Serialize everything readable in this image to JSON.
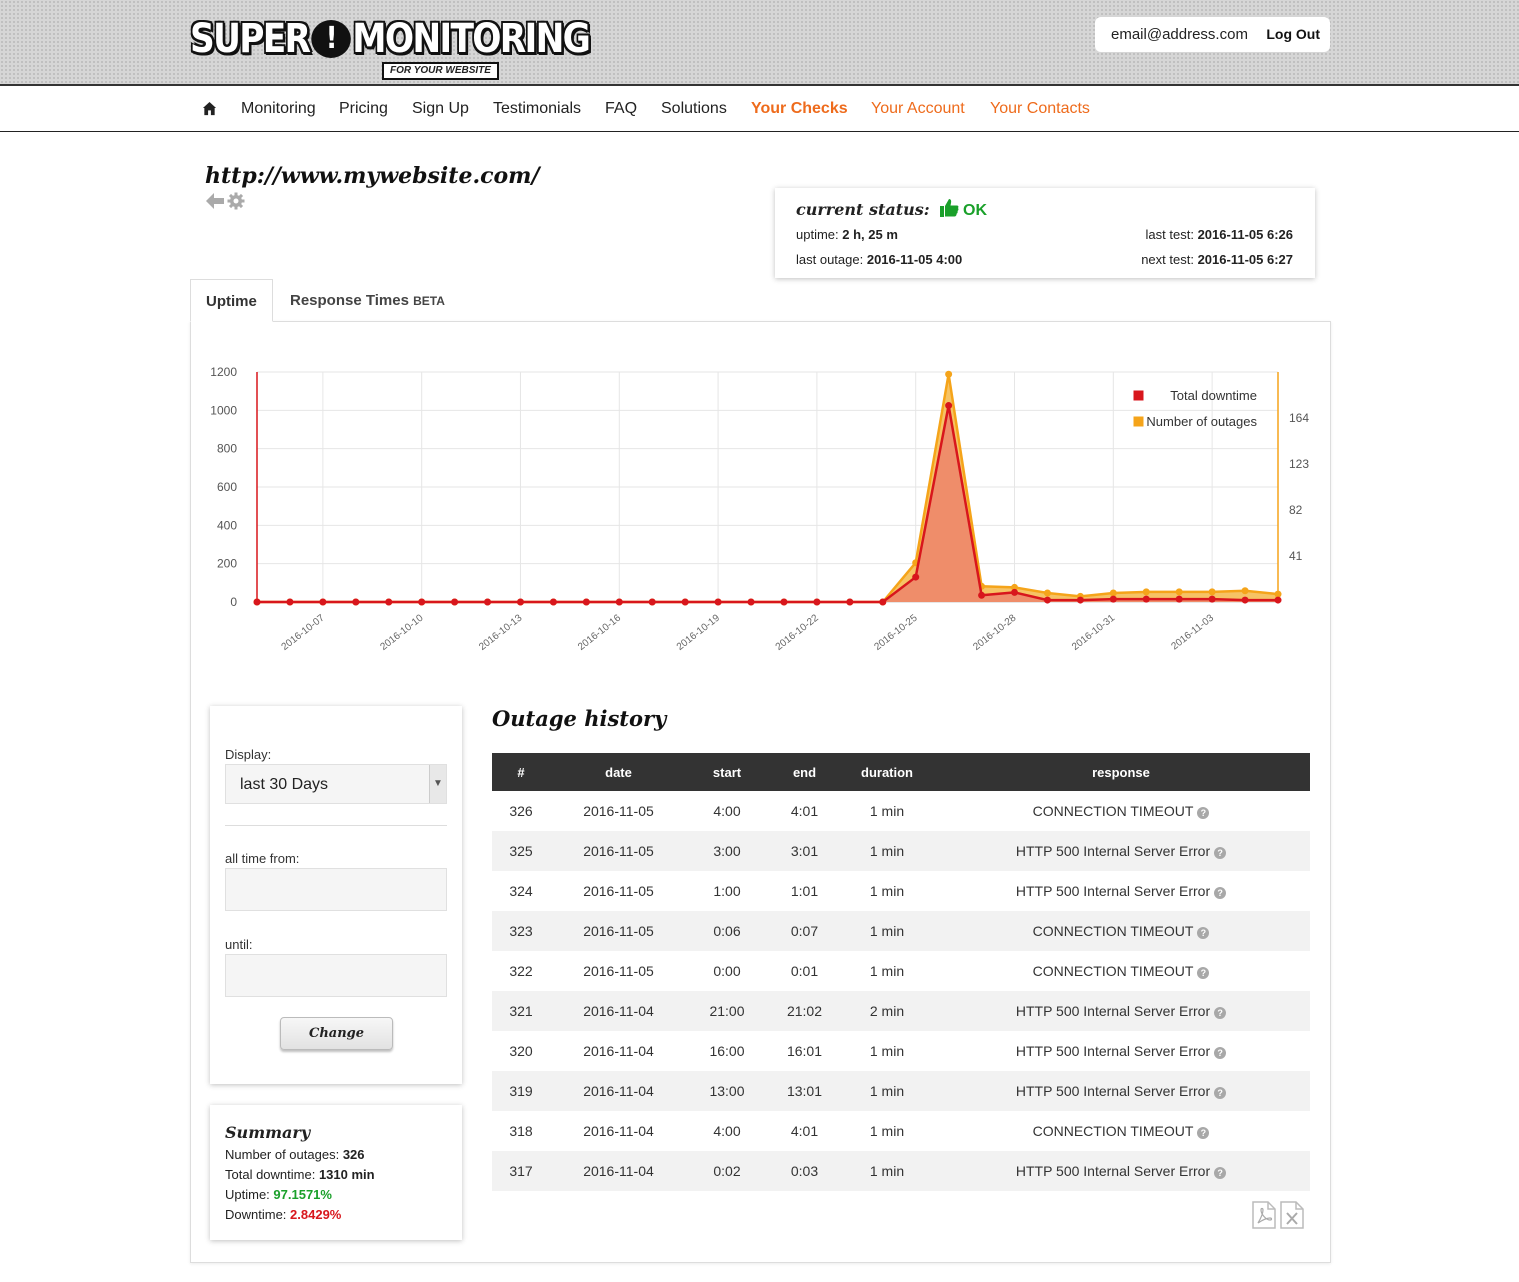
{
  "header": {
    "logo_main_left": "SUPER",
    "logo_mark": "!",
    "logo_main_right": "MONITORING",
    "logo_sub": "FOR YOUR WEBSITE",
    "email": "email@address.com",
    "logout_label": "Log Out"
  },
  "nav": {
    "home_icon": "home-icon",
    "items": [
      "Monitoring",
      "Pricing",
      "Sign Up",
      "Testimonials",
      "FAQ",
      "Solutions",
      "Your Checks",
      "Your Account",
      "Your Contacts"
    ],
    "accent_color": "#ee6b1c"
  },
  "site": {
    "url": "http://www.mywebsite.com/"
  },
  "status": {
    "title": "current status:",
    "state": "OK",
    "uptime_label": "uptime:",
    "uptime_value": "2 h, 25 m",
    "last_outage_label": "last outage:",
    "last_outage_value": "2016-11-05 4:00",
    "last_test_label": "last test:",
    "last_test_value": "2016-11-05 6:26",
    "next_test_label": "next test:",
    "next_test_value": "2016-11-05 6:27",
    "ok_color": "#1aa02a"
  },
  "tabs": {
    "uptime": "Uptime",
    "response": "Response Times",
    "response_badge": "BETA"
  },
  "chart_data": {
    "type": "area",
    "x": [
      "2016-10-05",
      "2016-10-06",
      "2016-10-07",
      "2016-10-08",
      "2016-10-09",
      "2016-10-10",
      "2016-10-11",
      "2016-10-12",
      "2016-10-13",
      "2016-10-14",
      "2016-10-15",
      "2016-10-16",
      "2016-10-17",
      "2016-10-18",
      "2016-10-19",
      "2016-10-20",
      "2016-10-21",
      "2016-10-22",
      "2016-10-23",
      "2016-10-24",
      "2016-10-25",
      "2016-10-26",
      "2016-10-27",
      "2016-10-28",
      "2016-10-29",
      "2016-10-30",
      "2016-10-31",
      "2016-11-01",
      "2016-11-02",
      "2016-11-03",
      "2016-11-04",
      "2016-11-05"
    ],
    "x_tick_labels": [
      "2016-10-07",
      "2016-10-10",
      "2016-10-13",
      "2016-10-16",
      "2016-10-19",
      "2016-10-22",
      "2016-10-25",
      "2016-10-28",
      "2016-10-31",
      "2016-11-03"
    ],
    "series": [
      {
        "name": "Total downtime",
        "axis": "left",
        "color": "#d8161c",
        "fill": "#ee8a6a",
        "values": [
          0,
          0,
          0,
          0,
          0,
          0,
          0,
          0,
          0,
          0,
          0,
          0,
          0,
          0,
          0,
          0,
          0,
          0,
          0,
          0,
          130,
          1025,
          35,
          50,
          10,
          10,
          15,
          15,
          15,
          15,
          10,
          10
        ]
      },
      {
        "name": "Number of outages",
        "axis": "right",
        "color": "#f5a41a",
        "fill": "#f5b84a",
        "values": [
          0,
          0,
          0,
          0,
          0,
          0,
          0,
          0,
          0,
          0,
          0,
          0,
          0,
          0,
          0,
          0,
          0,
          0,
          0,
          0,
          35,
          203,
          14,
          13,
          8,
          5,
          8,
          9,
          9,
          9,
          10,
          7
        ]
      }
    ],
    "y_left": {
      "ylim": [
        0,
        1200
      ],
      "ticks": [
        0,
        200,
        400,
        600,
        800,
        1000,
        1200
      ]
    },
    "y_right": {
      "ylim": [
        0,
        205
      ],
      "ticks": [
        41,
        82,
        123,
        164
      ]
    },
    "grid": true,
    "legend_position": "top-right"
  },
  "filters": {
    "display_label": "Display:",
    "display_value": "last 30 Days",
    "from_label": "all time from:",
    "until_label": "until:",
    "from_value": "",
    "until_value": "",
    "change_label": "Change"
  },
  "summary": {
    "title": "Summary",
    "outages_label": "Number of outages:",
    "outages_value": "326",
    "downtime_label": "Total downtime:",
    "downtime_value": "1310 min",
    "uptime_label": "Uptime:",
    "uptime_value": "97.1571%",
    "downtime_pct_label": "Downtime:",
    "downtime_pct_value": "2.8429%"
  },
  "outages": {
    "title": "Outage history",
    "columns": [
      "#",
      "date",
      "start",
      "end",
      "duration",
      "response"
    ],
    "rows": [
      [
        "326",
        "2016-11-05",
        "4:00",
        "4:01",
        "1 min",
        "CONNECTION TIMEOUT"
      ],
      [
        "325",
        "2016-11-05",
        "3:00",
        "3:01",
        "1 min",
        "HTTP 500 Internal Server Error"
      ],
      [
        "324",
        "2016-11-05",
        "1:00",
        "1:01",
        "1 min",
        "HTTP 500 Internal Server Error"
      ],
      [
        "323",
        "2016-11-05",
        "0:06",
        "0:07",
        "1 min",
        "CONNECTION TIMEOUT"
      ],
      [
        "322",
        "2016-11-05",
        "0:00",
        "0:01",
        "1 min",
        "CONNECTION TIMEOUT"
      ],
      [
        "321",
        "2016-11-04",
        "21:00",
        "21:02",
        "2 min",
        "HTTP 500 Internal Server Error"
      ],
      [
        "320",
        "2016-11-04",
        "16:00",
        "16:01",
        "1 min",
        "HTTP 500 Internal Server Error"
      ],
      [
        "319",
        "2016-11-04",
        "13:00",
        "13:01",
        "1 min",
        "HTTP 500 Internal Server Error"
      ],
      [
        "318",
        "2016-11-04",
        "4:00",
        "4:01",
        "1 min",
        "CONNECTION TIMEOUT"
      ],
      [
        "317",
        "2016-11-04",
        "0:02",
        "0:03",
        "1 min",
        "HTTP 500 Internal Server Error"
      ]
    ],
    "export_icons": [
      "pdf-icon",
      "excel-icon"
    ]
  }
}
